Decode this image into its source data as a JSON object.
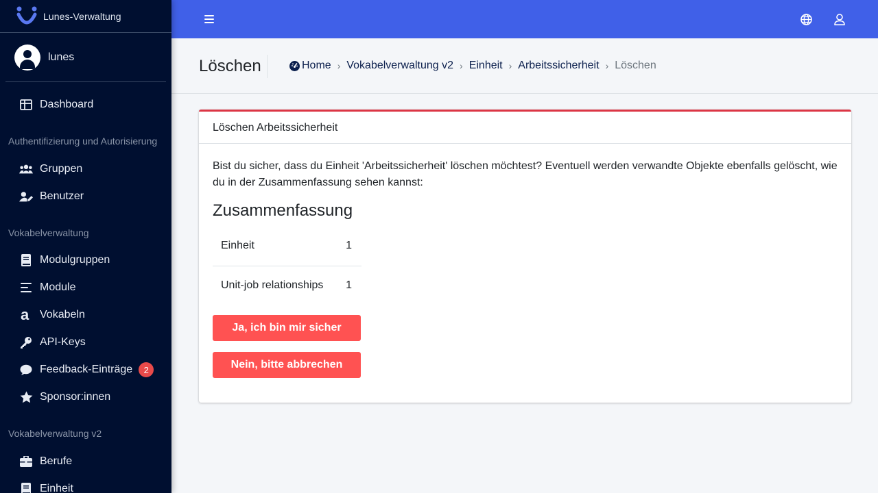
{
  "brand": {
    "name": "Lunes-Verwaltung"
  },
  "user": {
    "name": "lunes"
  },
  "sidebar": {
    "dashboard": "Dashboard",
    "section_auth": "Authentifizierung und Autorisierung",
    "groups": "Gruppen",
    "users": "Benutzer",
    "section_vocab": "Vokabelverwaltung",
    "module_groups": "Modulgruppen",
    "modules": "Module",
    "vocab": "Vokabeln",
    "api_keys": "API-Keys",
    "feedback": "Feedback-Einträge",
    "feedback_badge": "2",
    "sponsors": "Sponsor:innen",
    "section_vocab_v2": "Vokabelverwaltung v2",
    "jobs": "Berufe",
    "unit": "Einheit"
  },
  "header": {
    "title": "Löschen",
    "breadcrumb": [
      "Home",
      "Vokabelverwaltung v2",
      "Einheit",
      "Arbeitssicherheit"
    ],
    "breadcrumb_active": "Löschen"
  },
  "card": {
    "title": "Löschen Arbeitssicherheit",
    "confirm_text": "Bist du sicher, dass du Einheit 'Arbeitssicherheit' löschen möchtest? Eventuell werden verwandte Objekte ebenfalls gelöscht, wie du in der Zusammenfassung sehen kannst:",
    "summary_title": "Zusammenfassung",
    "summary_rows": [
      {
        "label": "Einheit",
        "count": "1"
      },
      {
        "label": "Unit-job relationships",
        "count": "1"
      }
    ],
    "confirm_button": "Ja, ich bin mir sicher",
    "cancel_button": "Nein, bitte abbrechen"
  },
  "colors": {
    "sidebar_bg": "#000f30",
    "navbar_bg": "#4060e8",
    "danger": "#ff5252",
    "card_top_border": "#dc3545"
  }
}
